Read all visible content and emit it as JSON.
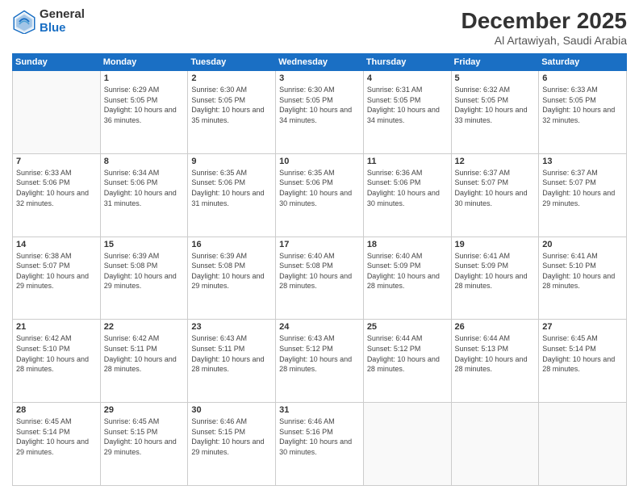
{
  "logo": {
    "general": "General",
    "blue": "Blue"
  },
  "header": {
    "month": "December 2025",
    "location": "Al Artawiyah, Saudi Arabia"
  },
  "days_of_week": [
    "Sunday",
    "Monday",
    "Tuesday",
    "Wednesday",
    "Thursday",
    "Friday",
    "Saturday"
  ],
  "weeks": [
    [
      {
        "day": "",
        "sunrise": "",
        "sunset": "",
        "daylight": ""
      },
      {
        "day": "1",
        "sunrise": "Sunrise: 6:29 AM",
        "sunset": "Sunset: 5:05 PM",
        "daylight": "Daylight: 10 hours and 36 minutes."
      },
      {
        "day": "2",
        "sunrise": "Sunrise: 6:30 AM",
        "sunset": "Sunset: 5:05 PM",
        "daylight": "Daylight: 10 hours and 35 minutes."
      },
      {
        "day": "3",
        "sunrise": "Sunrise: 6:30 AM",
        "sunset": "Sunset: 5:05 PM",
        "daylight": "Daylight: 10 hours and 34 minutes."
      },
      {
        "day": "4",
        "sunrise": "Sunrise: 6:31 AM",
        "sunset": "Sunset: 5:05 PM",
        "daylight": "Daylight: 10 hours and 34 minutes."
      },
      {
        "day": "5",
        "sunrise": "Sunrise: 6:32 AM",
        "sunset": "Sunset: 5:05 PM",
        "daylight": "Daylight: 10 hours and 33 minutes."
      },
      {
        "day": "6",
        "sunrise": "Sunrise: 6:33 AM",
        "sunset": "Sunset: 5:05 PM",
        "daylight": "Daylight: 10 hours and 32 minutes."
      }
    ],
    [
      {
        "day": "7",
        "sunrise": "Sunrise: 6:33 AM",
        "sunset": "Sunset: 5:06 PM",
        "daylight": "Daylight: 10 hours and 32 minutes."
      },
      {
        "day": "8",
        "sunrise": "Sunrise: 6:34 AM",
        "sunset": "Sunset: 5:06 PM",
        "daylight": "Daylight: 10 hours and 31 minutes."
      },
      {
        "day": "9",
        "sunrise": "Sunrise: 6:35 AM",
        "sunset": "Sunset: 5:06 PM",
        "daylight": "Daylight: 10 hours and 31 minutes."
      },
      {
        "day": "10",
        "sunrise": "Sunrise: 6:35 AM",
        "sunset": "Sunset: 5:06 PM",
        "daylight": "Daylight: 10 hours and 30 minutes."
      },
      {
        "day": "11",
        "sunrise": "Sunrise: 6:36 AM",
        "sunset": "Sunset: 5:06 PM",
        "daylight": "Daylight: 10 hours and 30 minutes."
      },
      {
        "day": "12",
        "sunrise": "Sunrise: 6:37 AM",
        "sunset": "Sunset: 5:07 PM",
        "daylight": "Daylight: 10 hours and 30 minutes."
      },
      {
        "day": "13",
        "sunrise": "Sunrise: 6:37 AM",
        "sunset": "Sunset: 5:07 PM",
        "daylight": "Daylight: 10 hours and 29 minutes."
      }
    ],
    [
      {
        "day": "14",
        "sunrise": "Sunrise: 6:38 AM",
        "sunset": "Sunset: 5:07 PM",
        "daylight": "Daylight: 10 hours and 29 minutes."
      },
      {
        "day": "15",
        "sunrise": "Sunrise: 6:39 AM",
        "sunset": "Sunset: 5:08 PM",
        "daylight": "Daylight: 10 hours and 29 minutes."
      },
      {
        "day": "16",
        "sunrise": "Sunrise: 6:39 AM",
        "sunset": "Sunset: 5:08 PM",
        "daylight": "Daylight: 10 hours and 29 minutes."
      },
      {
        "day": "17",
        "sunrise": "Sunrise: 6:40 AM",
        "sunset": "Sunset: 5:08 PM",
        "daylight": "Daylight: 10 hours and 28 minutes."
      },
      {
        "day": "18",
        "sunrise": "Sunrise: 6:40 AM",
        "sunset": "Sunset: 5:09 PM",
        "daylight": "Daylight: 10 hours and 28 minutes."
      },
      {
        "day": "19",
        "sunrise": "Sunrise: 6:41 AM",
        "sunset": "Sunset: 5:09 PM",
        "daylight": "Daylight: 10 hours and 28 minutes."
      },
      {
        "day": "20",
        "sunrise": "Sunrise: 6:41 AM",
        "sunset": "Sunset: 5:10 PM",
        "daylight": "Daylight: 10 hours and 28 minutes."
      }
    ],
    [
      {
        "day": "21",
        "sunrise": "Sunrise: 6:42 AM",
        "sunset": "Sunset: 5:10 PM",
        "daylight": "Daylight: 10 hours and 28 minutes."
      },
      {
        "day": "22",
        "sunrise": "Sunrise: 6:42 AM",
        "sunset": "Sunset: 5:11 PM",
        "daylight": "Daylight: 10 hours and 28 minutes."
      },
      {
        "day": "23",
        "sunrise": "Sunrise: 6:43 AM",
        "sunset": "Sunset: 5:11 PM",
        "daylight": "Daylight: 10 hours and 28 minutes."
      },
      {
        "day": "24",
        "sunrise": "Sunrise: 6:43 AM",
        "sunset": "Sunset: 5:12 PM",
        "daylight": "Daylight: 10 hours and 28 minutes."
      },
      {
        "day": "25",
        "sunrise": "Sunrise: 6:44 AM",
        "sunset": "Sunset: 5:12 PM",
        "daylight": "Daylight: 10 hours and 28 minutes."
      },
      {
        "day": "26",
        "sunrise": "Sunrise: 6:44 AM",
        "sunset": "Sunset: 5:13 PM",
        "daylight": "Daylight: 10 hours and 28 minutes."
      },
      {
        "day": "27",
        "sunrise": "Sunrise: 6:45 AM",
        "sunset": "Sunset: 5:14 PM",
        "daylight": "Daylight: 10 hours and 28 minutes."
      }
    ],
    [
      {
        "day": "28",
        "sunrise": "Sunrise: 6:45 AM",
        "sunset": "Sunset: 5:14 PM",
        "daylight": "Daylight: 10 hours and 29 minutes."
      },
      {
        "day": "29",
        "sunrise": "Sunrise: 6:45 AM",
        "sunset": "Sunset: 5:15 PM",
        "daylight": "Daylight: 10 hours and 29 minutes."
      },
      {
        "day": "30",
        "sunrise": "Sunrise: 6:46 AM",
        "sunset": "Sunset: 5:15 PM",
        "daylight": "Daylight: 10 hours and 29 minutes."
      },
      {
        "day": "31",
        "sunrise": "Sunrise: 6:46 AM",
        "sunset": "Sunset: 5:16 PM",
        "daylight": "Daylight: 10 hours and 30 minutes."
      },
      {
        "day": "",
        "sunrise": "",
        "sunset": "",
        "daylight": ""
      },
      {
        "day": "",
        "sunrise": "",
        "sunset": "",
        "daylight": ""
      },
      {
        "day": "",
        "sunrise": "",
        "sunset": "",
        "daylight": ""
      }
    ]
  ]
}
